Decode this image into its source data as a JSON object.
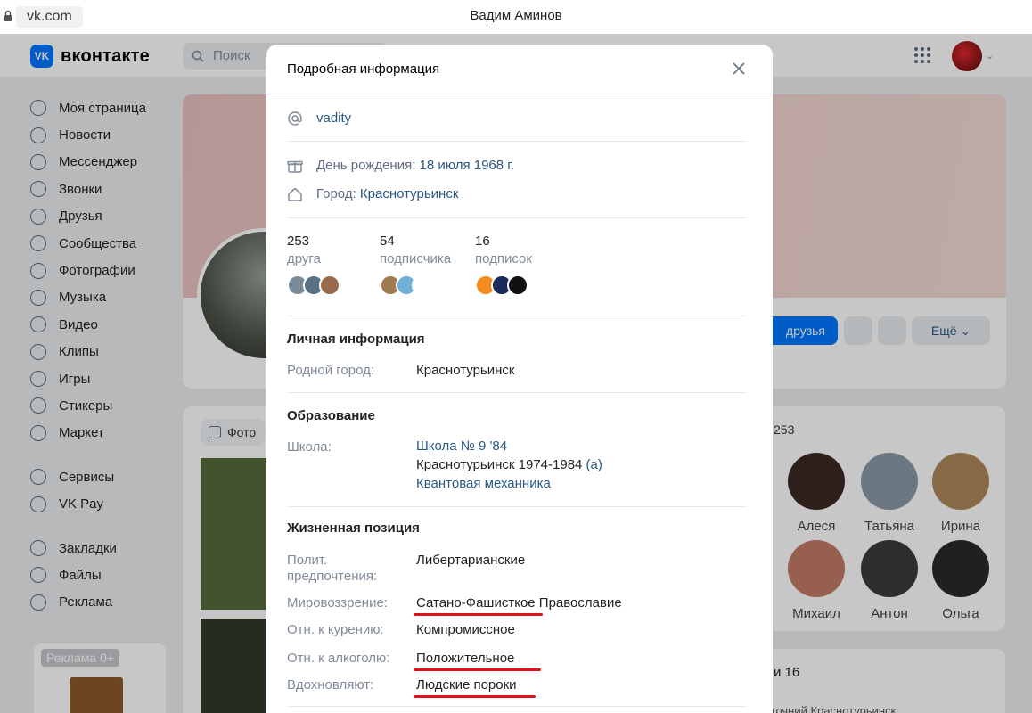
{
  "browser": {
    "url": "vk.com",
    "window_title": "Вадим Аминов"
  },
  "header": {
    "logo_mark": "VK",
    "logo_text": "вконтакте",
    "search_placeholder": "Поиск"
  },
  "sidebar": {
    "items": [
      {
        "label": "Моя страница",
        "icon": "user-circle-icon"
      },
      {
        "label": "Новости",
        "icon": "news-icon"
      },
      {
        "label": "Мессенджер",
        "icon": "message-icon"
      },
      {
        "label": "Звонки",
        "icon": "phone-icon"
      },
      {
        "label": "Друзья",
        "icon": "friends-icon"
      },
      {
        "label": "Сообщества",
        "icon": "groups-icon"
      },
      {
        "label": "Фотографии",
        "icon": "photo-icon"
      },
      {
        "label": "Музыка",
        "icon": "music-icon"
      },
      {
        "label": "Видео",
        "icon": "video-icon"
      },
      {
        "label": "Клипы",
        "icon": "clips-icon"
      },
      {
        "label": "Игры",
        "icon": "games-icon"
      },
      {
        "label": "Стикеры",
        "icon": "sticker-icon"
      },
      {
        "label": "Маркет",
        "icon": "market-icon"
      }
    ],
    "items2": [
      {
        "label": "Сервисы",
        "icon": "services-icon"
      },
      {
        "label": "VK Pay",
        "icon": "vkpay-icon"
      }
    ],
    "items3": [
      {
        "label": "Закладки",
        "icon": "bookmark-icon"
      },
      {
        "label": "Файлы",
        "icon": "file-icon"
      },
      {
        "label": "Реклама",
        "icon": "ads-icon"
      }
    ],
    "ad_label": "Реклама 0+"
  },
  "profile": {
    "friends_button": "друзья",
    "more_button": "Ещё",
    "photos_tab": "Фото"
  },
  "friends_block": {
    "count_partial": "253",
    "people": [
      {
        "name": "Алеся",
        "color": "#3a2a24"
      },
      {
        "name": "Татьяна",
        "color": "#8a9aa8"
      },
      {
        "name": "Ирина",
        "color": "#b0885a"
      },
      {
        "name": "Михаил",
        "color": "#c07a66"
      },
      {
        "name": "Антон",
        "color": "#3b3b3b"
      },
      {
        "name": "Ольга",
        "color": "#2a2a2a"
      }
    ]
  },
  "subs_block": {
    "heading_partial": "и 16",
    "line_partial": "гочний Краснотурьинск"
  },
  "modal": {
    "title": "Подробная информация",
    "username": "vadity",
    "birthday_label": "День рождения:",
    "birthday_value": "18 июля 1968 г.",
    "city_label": "Город:",
    "city_value": "Краснотурьинск",
    "stats": [
      {
        "num": "253",
        "label": "друга",
        "avatars": [
          "#7a8c9a",
          "#5a6f85",
          "#9a6b4a"
        ]
      },
      {
        "num": "54",
        "label": "подписчика",
        "avatars": [
          "#a07a50",
          "#6fb0d8",
          "#ffffff"
        ]
      },
      {
        "num": "16",
        "label": "подписок",
        "avatars": [
          "#f28c1e",
          "#1a2a5a",
          "#111111"
        ]
      }
    ],
    "personal": {
      "title": "Личная информация",
      "hometown_label": "Родной город:",
      "hometown_value": "Краснотурьинск"
    },
    "education": {
      "title": "Образование",
      "school_label": "Школа:",
      "school_name": "Школа № 9 '84",
      "school_detail": "Краснотурьинск 1974-1984",
      "school_class": "(а)",
      "school_spec": "Квантовая механника"
    },
    "position": {
      "title": "Жизненная позиция",
      "rows": [
        {
          "label": "Полит. предпочтения:",
          "value": "Либертарианские",
          "link": false
        },
        {
          "label": "Мировоззрение:",
          "value": "Сатано-Фашисткое Православие",
          "link": true
        },
        {
          "label": "Отн. к курению:",
          "value": "Компромиссное",
          "link": true
        },
        {
          "label": "Отн. к алкоголю:",
          "value": "Положительное",
          "link": true
        },
        {
          "label": "Вдохновляют:",
          "value": "Людские пороки",
          "link": true
        }
      ]
    },
    "underline_color": "#e0101a"
  }
}
